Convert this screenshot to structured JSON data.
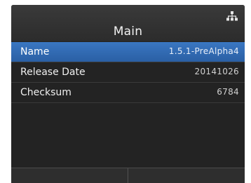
{
  "header": {
    "title": "Main",
    "network_icon": "network-icon"
  },
  "rows": [
    {
      "label": "Name",
      "value": "1.5.1-PreAlpha4",
      "selected": true
    },
    {
      "label": "Release Date",
      "value": "20141026",
      "selected": false
    },
    {
      "label": "Checksum",
      "value": "6784",
      "selected": false
    }
  ],
  "colors": {
    "selection": "#2a5fa4",
    "background": "#232323"
  }
}
